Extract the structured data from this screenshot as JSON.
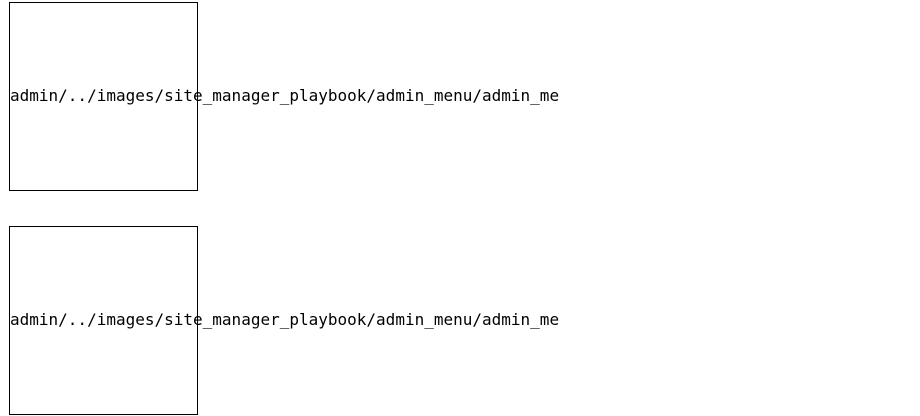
{
  "images": [
    {
      "alt": "admin/../images/site_manager_playbook/admin_menu/admin_me"
    },
    {
      "alt": "admin/../images/site_manager_playbook/admin_menu/admin_me"
    }
  ]
}
